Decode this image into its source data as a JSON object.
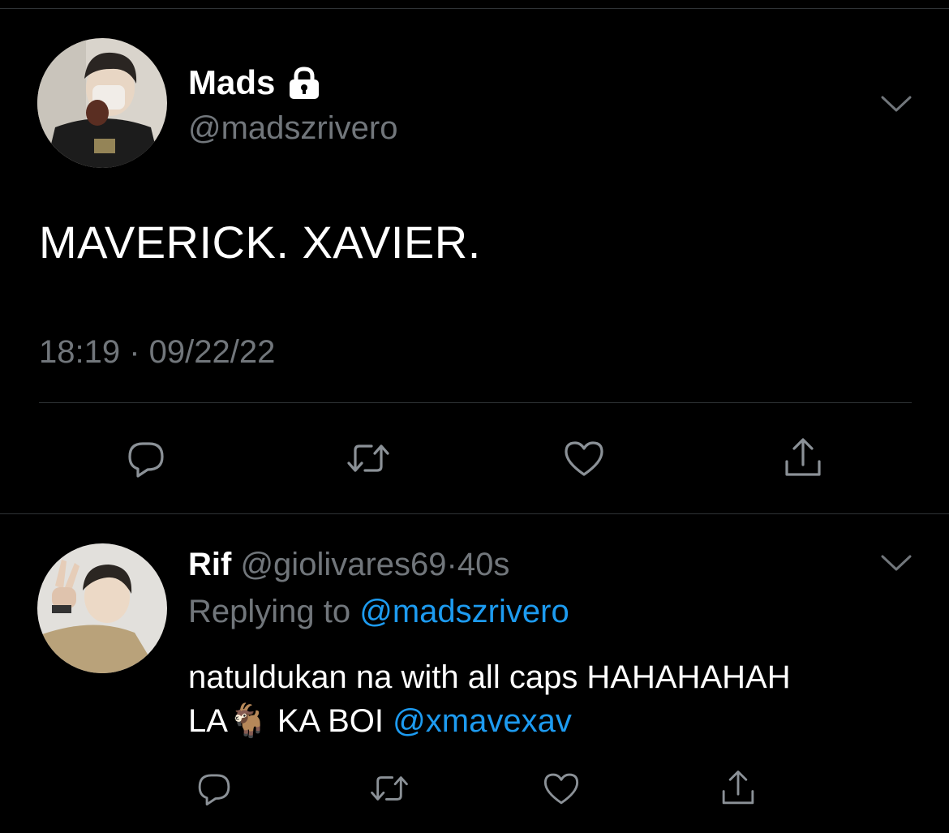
{
  "main_tweet": {
    "display_name": "Mads",
    "handle": "@madszrivero",
    "text": "MAVERICK. XAVIER.",
    "timestamp": "18:19 · 09/22/22",
    "avatar_icon": "user-photo-avatar",
    "protected_icon": "lock-icon"
  },
  "reply": {
    "display_name": "Rif",
    "handle": "@giolivares69",
    "separator": "·",
    "age": "40s",
    "replying_prefix": "Replying to",
    "replying_handle": "@madszrivero",
    "line1": "natuldukan na with all caps HAHAHAHAH",
    "line2_start": "LA",
    "emoji": "🐐",
    "line2_mid": " KA BOI ",
    "mention": "@xmavexav",
    "avatar_icon": "user-photo-avatar"
  },
  "actions": [
    "reply-icon",
    "retweet-icon",
    "like-icon",
    "share-icon"
  ],
  "colors": {
    "background": "#000000",
    "text": "#ffffff",
    "secondary": "#71767b",
    "link": "#1d9bf0",
    "divider": "#2f3336"
  }
}
